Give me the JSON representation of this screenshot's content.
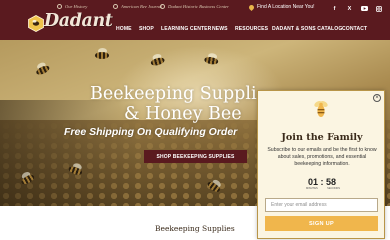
{
  "header": {
    "badges": [
      "Our History",
      "American Bee Journal",
      "Dadant Historic Business Center"
    ],
    "locator_label": "Find A Location Near You!",
    "logo_text": "Dadant",
    "social_icons": [
      "facebook-icon",
      "x-icon",
      "youtube-icon",
      "instagram-icon"
    ],
    "nav": [
      "HOME",
      "SHOP",
      "LEARNING CENTER",
      "NEWS",
      "RESOURCES",
      "DADANT & SONS CATALOG",
      "CONTACT"
    ]
  },
  "hero": {
    "title_line1": "Beekeeping Suppli",
    "title_line2": "& Honey Bee",
    "subtitle": "Free Shipping On Qualifying Order",
    "button_label": "SHOP BEEKEEPING SUPPLIES"
  },
  "section": {
    "title": "Beekeeping Supplies"
  },
  "popup": {
    "close_label": "×",
    "title": "Join the Family",
    "body": "Subscribe to our emails and be the first to know about sales, promotions, and essential beekeeping information.",
    "countdown": "01 : 58",
    "countdown_labels": [
      "MINUTES",
      "SECONDS"
    ],
    "email_placeholder": "Enter your email address",
    "signup_label": "SIGN UP"
  },
  "colors": {
    "header_bg": "#5a1a1f",
    "accent": "#f0b64c",
    "popup_bg": "#fbf5e2"
  }
}
